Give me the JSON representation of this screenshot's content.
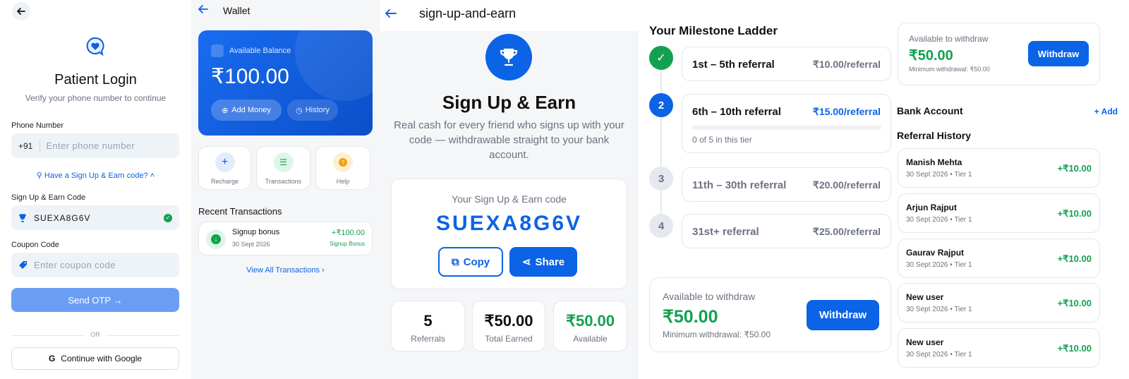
{
  "login": {
    "title": "Patient Login",
    "subtitle": "Verify your phone number to continue",
    "phone_label": "Phone Number",
    "country_code": "+91",
    "phone_placeholder": "Enter phone number",
    "code_toggle": "Have a Sign Up & Earn code?",
    "code_label": "Sign Up & Earn Code",
    "code_value": "SUEXA8G6V",
    "coupon_label": "Coupon Code",
    "coupon_placeholder": "Enter coupon code",
    "send_otp": "Send OTP",
    "or": "OR",
    "google": "Continue with Google"
  },
  "wallet": {
    "title": "Wallet",
    "balance_label": "Available Balance",
    "balance": "₹100.00",
    "add_money": "Add Money",
    "history": "History",
    "actions": [
      {
        "label": "Recharge",
        "icon": "plus-icon"
      },
      {
        "label": "Transactions",
        "icon": "list-icon"
      },
      {
        "label": "Help",
        "icon": "help-icon"
      }
    ],
    "recent_title": "Recent Transactions",
    "transactions": [
      {
        "title": "Signup bonus",
        "date": "30 Sept 2026",
        "amount": "+₹100.00",
        "tag": "Signup Bonus"
      }
    ],
    "view_all": "View All Transactions"
  },
  "earn": {
    "header": "sign-up-and-earn",
    "title": "Sign Up & Earn",
    "desc": "Real cash for every friend who signs up with your code — withdrawable straight to your bank account.",
    "code_label": "Your Sign Up & Earn code",
    "code": "SUEXA8G6V",
    "copy": "Copy",
    "share": "Share",
    "stats": [
      {
        "value": "5",
        "label": "Referrals"
      },
      {
        "value": "₹50.00",
        "label": "Total Earned"
      },
      {
        "value": "₹50.00",
        "label": "Available"
      }
    ]
  },
  "ladder": {
    "title": "Your Milestone Ladder",
    "tiers": [
      {
        "num": "✓",
        "label": "1st – 5th referral",
        "rate": "₹10.00/referral"
      },
      {
        "num": "2",
        "label": "6th – 10th referral",
        "rate": "₹15.00/referral",
        "progress_text": "0 of 5 in this tier",
        "progress": 0
      },
      {
        "num": "3",
        "label": "11th – 30th referral",
        "rate": "₹20.00/referral"
      },
      {
        "num": "4",
        "label": "31st+ referral",
        "rate": "₹25.00/referral"
      }
    ],
    "withdraw": {
      "label": "Available to withdraw",
      "amount": "₹50.00",
      "min": "Minimum withdrawal: ₹50.00",
      "button": "Withdraw"
    }
  },
  "history": {
    "withdraw": {
      "label": "Available to withdraw",
      "amount": "₹50.00",
      "min": "Minimum withdrawal: ₹50.00",
      "button": "Withdraw"
    },
    "bank_title": "Bank Account",
    "add": "+ Add",
    "ref_title": "Referral History",
    "items": [
      {
        "name": "Manish Mehta",
        "meta": "30 Sept 2026 • Tier 1",
        "amount": "+₹10.00"
      },
      {
        "name": "Arjun Rajput",
        "meta": "30 Sept 2026 • Tier 1",
        "amount": "+₹10.00"
      },
      {
        "name": "Gaurav Rajput",
        "meta": "30 Sept 2026 • Tier 1",
        "amount": "+₹10.00"
      },
      {
        "name": "New user",
        "meta": "30 Sept 2026 • Tier 1",
        "amount": "+₹10.00"
      },
      {
        "name": "New user",
        "meta": "30 Sept 2026 • Tier 1",
        "amount": "+₹10.00"
      }
    ]
  },
  "colors": {
    "primary": "#0b63e5",
    "green": "#12a150",
    "light_bg": "#f5f6f8"
  }
}
